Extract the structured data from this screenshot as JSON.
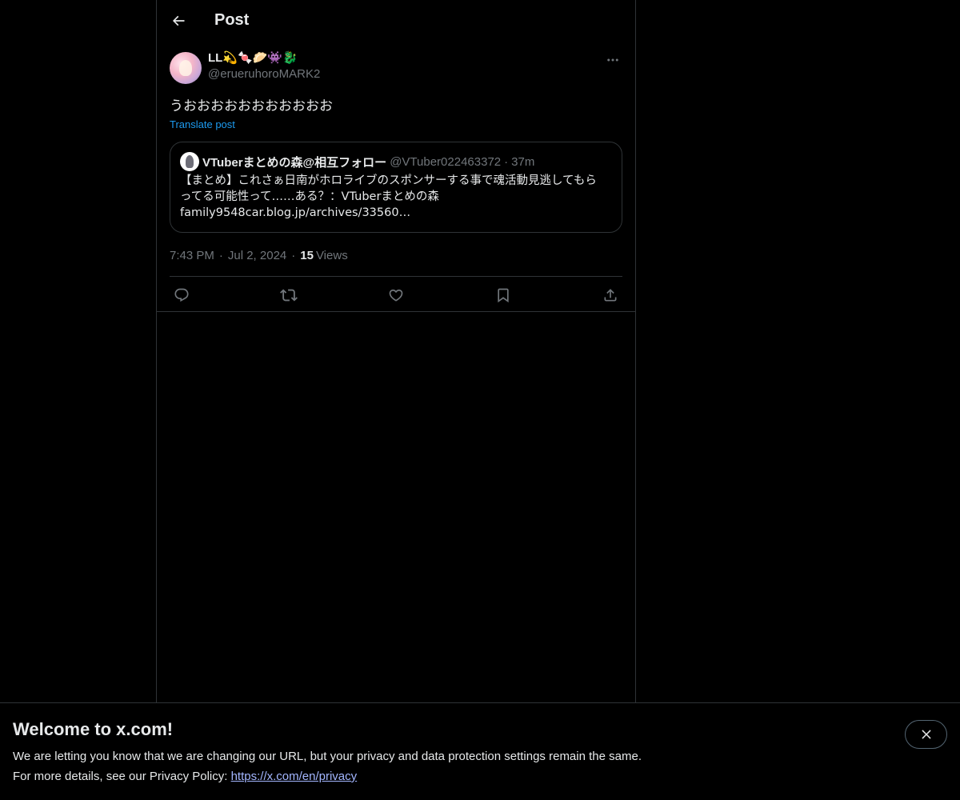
{
  "header": {
    "title": "Post"
  },
  "post": {
    "display_name": "LL💫🍬🥟👾🐉",
    "handle": "@erueruhoroMARK2",
    "text": "うおおおおおおおおおおお",
    "translate_label": "Translate post",
    "timestamp_time": "7:43 PM",
    "timestamp_date": "Jul 2, 2024",
    "views_count": "15",
    "views_label": "Views"
  },
  "quote": {
    "display_name": "VTuberまとめの森@相互フォロー",
    "handle": "@VTuber022463372",
    "time": "37m",
    "line1": "【まとめ】これさぁ日南がホロライブのスポンサーする事で魂活動見逃してもら",
    "line2": "ってる可能性って……ある？：VTuberまとめの森",
    "line3": "family9548car.blog.jp/archives/33560…"
  },
  "banner": {
    "title": "Welcome to x.com!",
    "line1": "We are letting you know that we are changing our URL, but your privacy and data protection settings remain the same.",
    "line2_prefix": "For more details, see our Privacy Policy: ",
    "link": "https://x.com/en/privacy"
  },
  "icons": {
    "back": "arrow-left-icon",
    "more": "more-horizontal-icon",
    "reply": "reply-icon",
    "repost": "repost-icon",
    "like": "heart-icon",
    "bookmark": "bookmark-icon",
    "share": "share-icon",
    "close": "close-icon"
  },
  "colors": {
    "background": "#000000",
    "text": "#e7e9ea",
    "muted": "#71767b",
    "accent": "#1d9bf0",
    "border": "#2f3336"
  }
}
